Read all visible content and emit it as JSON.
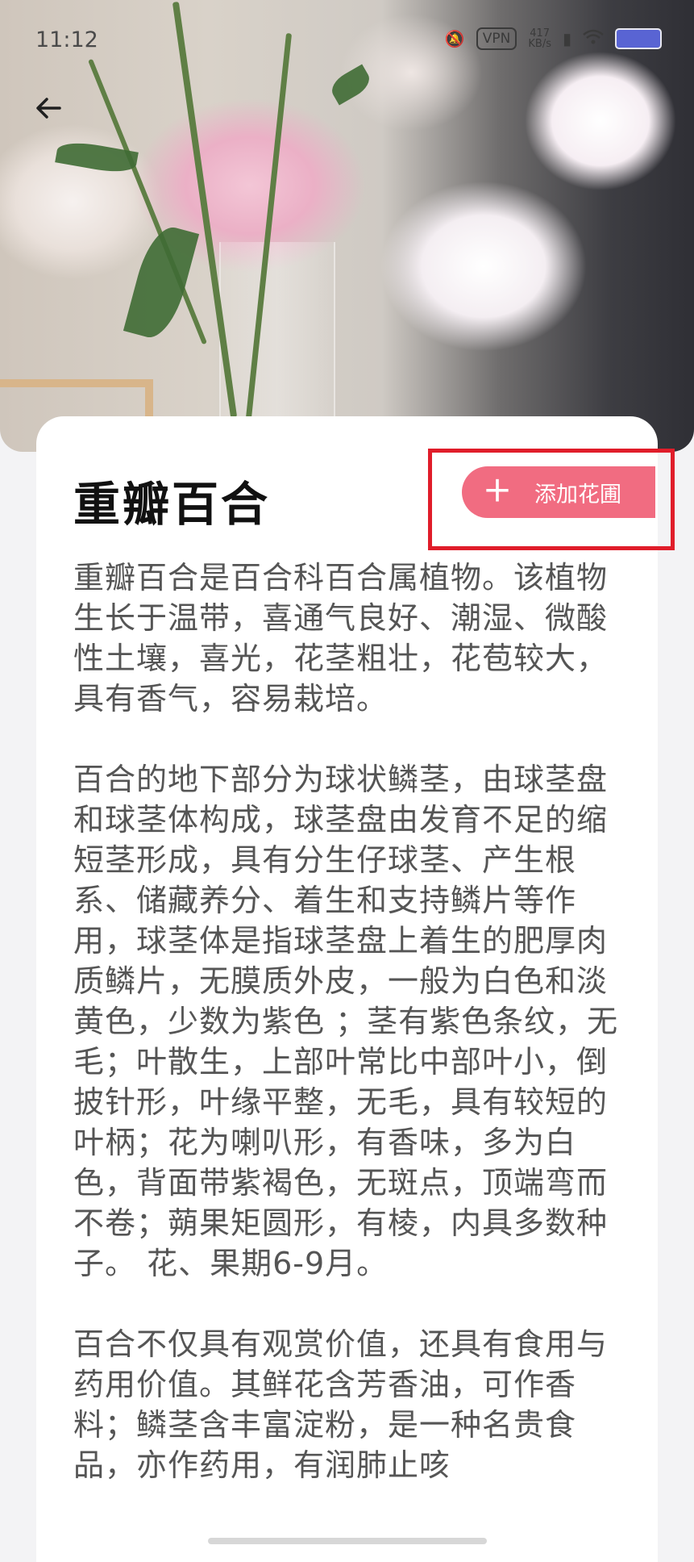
{
  "status_bar": {
    "time": "11:12",
    "vpn": "VPN",
    "net_speed_value": "417",
    "net_speed_unit": "KB/s"
  },
  "plant": {
    "name": "重瓣百合"
  },
  "actions": {
    "add_garden_label": "添加花圃",
    "add_garden_color": "#f16c81",
    "highlight_color": "#e01d2a"
  },
  "description": {
    "paragraphs": [
      "重瓣百合是百合科百合属植物。该植物生长于温带，喜通气良好、潮湿、微酸性土壤，喜光，花茎粗壮，花苞较大，具有香气，容易栽培。",
      "百合的地下部分为球状鳞茎，由球茎盘和球茎体构成，球茎盘由发育不足的缩短茎形成，具有分生仔球茎、产生根系、储藏养分、着生和支持鳞片等作用，球茎体是指球茎盘上着生的肥厚肉质鳞片，无膜质外皮，一般为白色和淡黄色，少数为紫色 ；茎有紫色条纹，无毛；叶散生，上部叶常比中部叶小，倒披针形，叶缘平整，无毛，具有较短的叶柄；花为喇叭形，有香味，多为白色，背面带紫褐色，无斑点，顶端弯而不卷；蒴果矩圆形，有棱，内具多数种子。 花、果期6-9月。",
      "百合不仅具有观赏价值，还具有食用与药用价值。其鲜花含芳香油，可作香料；鳞茎含丰富淀粉，是一种名贵食品，亦作药用，有润肺止咳"
    ]
  }
}
